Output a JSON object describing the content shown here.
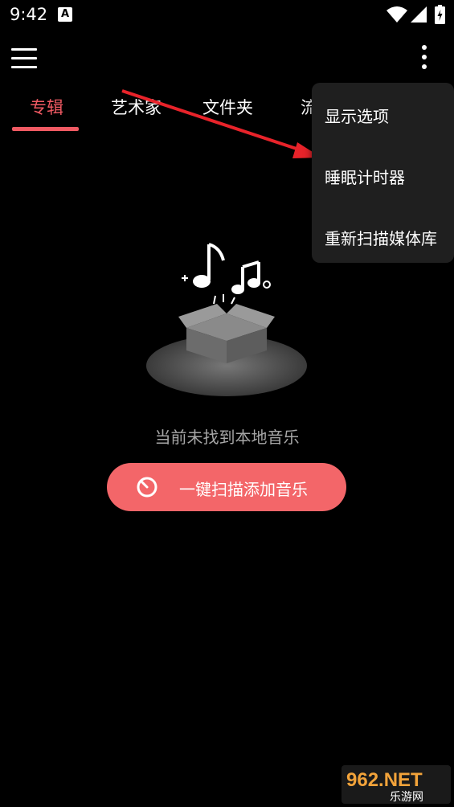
{
  "status_bar": {
    "time": "9:42",
    "notification_icon": "A"
  },
  "toolbar": {
    "menu_icon": "hamburger-menu-icon",
    "overflow_icon": "more-vert-icon"
  },
  "tabs": [
    {
      "label": "专辑",
      "active": true
    },
    {
      "label": "艺术家",
      "active": false
    },
    {
      "label": "文件夹",
      "active": false
    },
    {
      "label": "流",
      "active": false
    }
  ],
  "popup_menu": {
    "items": [
      {
        "label": "显示选项"
      },
      {
        "label": "睡眠计时器"
      },
      {
        "label": "重新扫描媒体库"
      }
    ]
  },
  "empty_state": {
    "message": "当前未找到本地音乐",
    "button_label": "一键扫描添加音乐"
  },
  "watermark": {
    "brand": "962.NET",
    "sub": "乐游网"
  },
  "colors": {
    "accent": "#f05a63",
    "button": "#f36669",
    "background": "#000000",
    "popup": "#1f1f1f",
    "arrow": "#e8232a"
  }
}
